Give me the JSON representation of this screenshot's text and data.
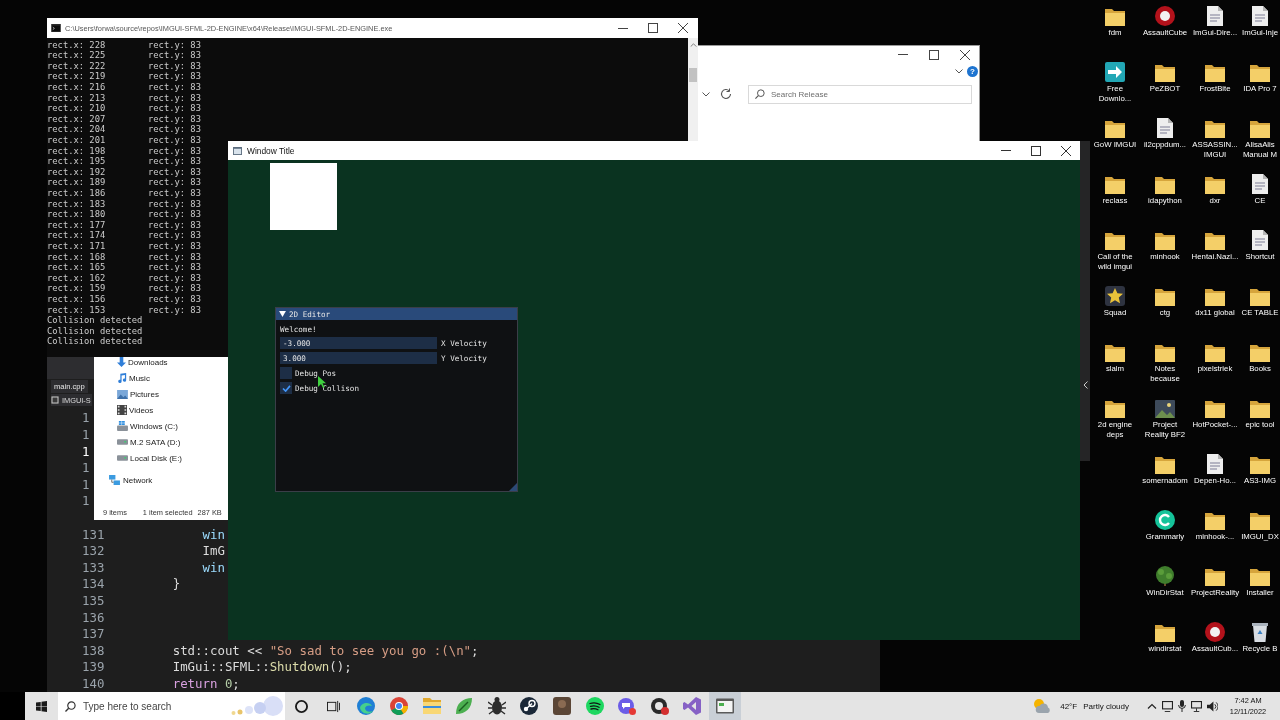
{
  "console_window": {
    "title": "C:\\Users\\forwa\\source\\repos\\IMGUI-SFML-2D-ENGINE\\x64\\Release\\IMGUI-SFML-2D-ENGINE.exe",
    "lines": [
      [
        "rect.x: 228",
        "rect.y: 83"
      ],
      [
        "rect.x: 225",
        "rect.y: 83"
      ],
      [
        "rect.x: 222",
        "rect.y: 83"
      ],
      [
        "rect.x: 219",
        "rect.y: 83"
      ],
      [
        "rect.x: 216",
        "rect.y: 83"
      ],
      [
        "rect.x: 213",
        "rect.y: 83"
      ],
      [
        "rect.x: 210",
        "rect.y: 83"
      ],
      [
        "rect.x: 207",
        "rect.y: 83"
      ],
      [
        "rect.x: 204",
        "rect.y: 83"
      ],
      [
        "rect.x: 201",
        "rect.y: 83"
      ],
      [
        "rect.x: 198",
        "rect.y: 83"
      ],
      [
        "rect.x: 195",
        "rect.y: 83"
      ],
      [
        "rect.x: 192",
        "rect.y: 83"
      ],
      [
        "rect.x: 189",
        "rect.y: 83"
      ],
      [
        "rect.x: 186",
        "rect.y: 83"
      ],
      [
        "rect.x: 183",
        "rect.y: 83"
      ],
      [
        "rect.x: 180",
        "rect.y: 83"
      ],
      [
        "rect.x: 177",
        "rect.y: 83"
      ],
      [
        "rect.x: 174",
        "rect.y: 83"
      ],
      [
        "rect.x: 171",
        "rect.y: 83"
      ],
      [
        "rect.x: 168",
        "rect.y: 83"
      ],
      [
        "rect.x: 165",
        "rect.y: 83"
      ],
      [
        "rect.x: 162",
        "rect.y: 83"
      ],
      [
        "rect.x: 159",
        "rect.y: 83"
      ],
      [
        "rect.x: 156",
        "rect.y: 83"
      ],
      [
        "rect.x: 153",
        "rect.y: 83"
      ],
      [
        "Collision detected"
      ],
      [
        "Collision detected"
      ],
      [
        "Collision detected"
      ]
    ]
  },
  "explorer_window": {
    "help_button": "?",
    "search": {
      "placeholder": "Search Release"
    },
    "nav_items": [
      {
        "label": "Downloads",
        "kind": "download"
      },
      {
        "label": "Music",
        "kind": "music"
      },
      {
        "label": "Pictures",
        "kind": "pictures"
      },
      {
        "label": "Videos",
        "kind": "videos"
      },
      {
        "label": "Windows (C:)",
        "kind": "system-drive"
      },
      {
        "label": "M.2 SATA (D:)",
        "kind": "drive"
      },
      {
        "label": "Local Disk (E:)",
        "kind": "drive"
      }
    ],
    "nav_root_item": {
      "label": "Network",
      "kind": "network"
    },
    "status_bar": {
      "item_count": "9 items",
      "selection": "1 item selected",
      "size": "287 KB"
    }
  },
  "code_editor": {
    "tab": "main.cpp",
    "project_dropdown": "IMGUI-S",
    "blocks": [
      {
        "lines": [
          {
            "number": "1",
            "current": false
          },
          {
            "number": "1",
            "current": false
          },
          {
            "number": "1",
            "current": true
          },
          {
            "number": "1",
            "current": false
          },
          {
            "number": "1",
            "current": false
          },
          {
            "number": "1",
            "current": false
          }
        ]
      },
      {
        "lines": [
          {
            "number": "131",
            "current": false,
            "tokens": [
              {
                "kind": "ident",
                "text": "            win"
              }
            ]
          },
          {
            "number": "132",
            "current": false,
            "tokens": [
              {
                "kind": "plain",
                "text": "            ImG"
              }
            ]
          },
          {
            "number": "133",
            "current": false,
            "tokens": [
              {
                "kind": "ident",
                "text": "            win"
              }
            ]
          },
          {
            "number": "134",
            "current": false,
            "tokens": [
              {
                "kind": "plain",
                "text": "        }"
              }
            ]
          },
          {
            "number": "135",
            "current": false
          },
          {
            "number": "136",
            "current": false
          },
          {
            "number": "137",
            "current": false
          },
          {
            "number": "138",
            "current": false,
            "tokens": [
              {
                "kind": "plain",
                "text": "        std::cout << "
              },
              {
                "kind": "string",
                "text": "\"So sad to see you go :(\\n\""
              },
              {
                "kind": "plain",
                "text": ";"
              }
            ]
          },
          {
            "number": "139",
            "current": false,
            "tokens": [
              {
                "kind": "plain",
                "text": "        ImGui::SFML::"
              },
              {
                "kind": "function",
                "text": "Shutdown"
              },
              {
                "kind": "plain",
                "text": "();"
              }
            ]
          },
          {
            "number": "140",
            "current": false,
            "tokens": [
              {
                "kind": "keyword",
                "text": "        return"
              },
              {
                "kind": "number",
                "text": " 0"
              },
              {
                "kind": "plain",
                "text": ";"
              }
            ]
          }
        ]
      }
    ]
  },
  "game_window": {
    "title": "Window Title",
    "editor_panel": {
      "title": "2D Editor",
      "expanded": true,
      "text": "Welcome!",
      "inputs": [
        {
          "value": "-3.000",
          "label": "X Velocity"
        },
        {
          "value": "3.000",
          "label": "Y Velocity"
        }
      ],
      "checkboxes": [
        {
          "label": "Debug Pos",
          "checked": false
        },
        {
          "label": "Debug Collison",
          "checked": true
        }
      ]
    }
  },
  "desktop_icons": {
    "columns": [
      [
        {
          "label": "fdm",
          "kind": "folder"
        },
        {
          "label": "Free Downlo...",
          "kind": "downloader"
        },
        {
          "label": "GoW IMGUI",
          "kind": "folder"
        },
        {
          "label": "reclass",
          "kind": "folder"
        },
        {
          "label": "Call of the wild imgui",
          "kind": "folder"
        },
        {
          "label": "Squad",
          "kind": "emblem"
        },
        {
          "label": "slalm",
          "kind": "folder"
        },
        {
          "label": "2d engine deps",
          "kind": "folder"
        }
      ],
      [
        {
          "label": "AssaultCube",
          "kind": "disc"
        },
        {
          "label": "PeZBOT",
          "kind": "folder"
        },
        {
          "label": "il2cppdum...",
          "kind": "file"
        },
        {
          "label": "idapython",
          "kind": "folder"
        },
        {
          "label": "minhook",
          "kind": "folder"
        },
        {
          "label": "ctg",
          "kind": "folder"
        },
        {
          "label": "Notes because",
          "kind": "folder"
        },
        {
          "label": "Project Reality BF2",
          "kind": "picture"
        },
        {
          "label": "somernadom",
          "kind": "folder"
        },
        {
          "label": "Grammarly",
          "kind": "circle"
        },
        {
          "label": "WinDirStat",
          "kind": "tree"
        },
        {
          "label": "windirstat",
          "kind": "folder"
        }
      ],
      [
        {
          "label": "ImGui-Dire...",
          "kind": "file"
        },
        {
          "label": "FrostBite",
          "kind": "folder"
        },
        {
          "label": "ASSASSIN... IMGUI",
          "kind": "folder"
        },
        {
          "label": "dxr",
          "kind": "folder"
        },
        {
          "label": "Hentai.Nazi...",
          "kind": "folder"
        },
        {
          "label": "dx11 global",
          "kind": "folder"
        },
        {
          "label": "pixelstriek",
          "kind": "folder"
        },
        {
          "label": "HotPocket-...",
          "kind": "folder"
        },
        {
          "label": "Depen-Ho...",
          "kind": "file"
        },
        {
          "label": "minhook-...",
          "kind": "folder"
        },
        {
          "label": "ProjectReality",
          "kind": "folder"
        },
        {
          "label": "AssaultCub...",
          "kind": "disc"
        }
      ],
      [
        {
          "label": "ImGui-Inje",
          "kind": "file"
        },
        {
          "label": "IDA Pro 7",
          "kind": "folder"
        },
        {
          "label": "AlisaAlis Manual M",
          "kind": "folder"
        },
        {
          "label": "CE",
          "kind": "file"
        },
        {
          "label": "Shortcut",
          "kind": "file"
        },
        {
          "label": "CE TABLE",
          "kind": "folder"
        },
        {
          "label": "Books",
          "kind": "folder"
        },
        {
          "label": "epic tool",
          "kind": "folder"
        },
        {
          "label": "AS3-IMG",
          "kind": "folder"
        },
        {
          "label": "IMGUI_DX",
          "kind": "folder"
        },
        {
          "label": "Installer",
          "kind": "folder"
        },
        {
          "label": "Recycle B",
          "kind": "bin"
        }
      ]
    ]
  },
  "taskbar": {
    "search": {
      "placeholder": "Type here to search"
    },
    "apps": [
      {
        "selected": false
      },
      {
        "selected": false
      },
      {
        "selected": false
      },
      {
        "selected": false
      },
      {
        "selected": false
      },
      {
        "selected": false
      },
      {
        "selected": false
      },
      {
        "selected": false
      },
      {
        "selected": false
      },
      {
        "selected": false
      },
      {
        "selected": false
      },
      {
        "selected": true
      }
    ],
    "weather": {
      "temperature": "42°F",
      "condition": "Partly cloudy"
    },
    "clock": {
      "time": "7:42 AM",
      "date": "12/11/2022"
    }
  }
}
